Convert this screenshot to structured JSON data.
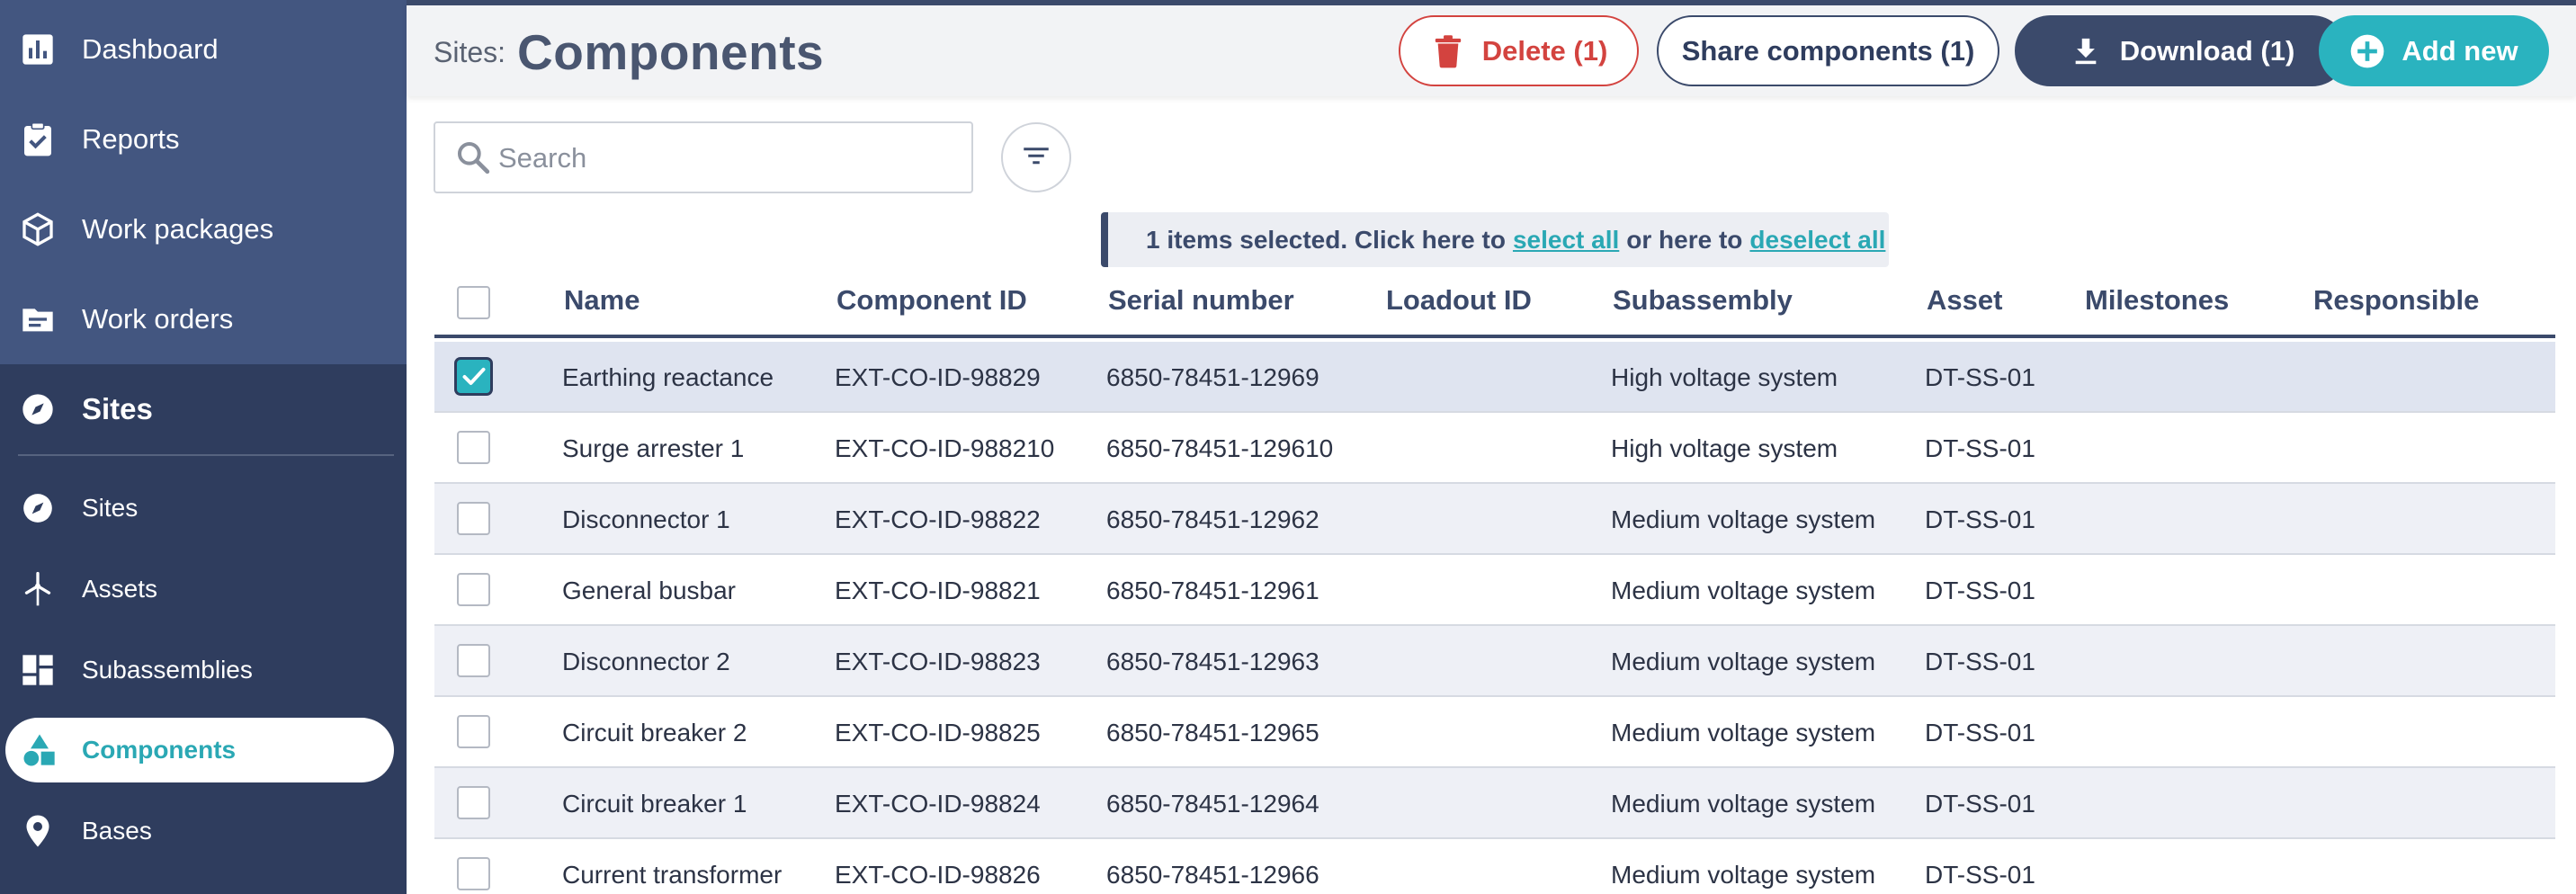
{
  "sidebar": {
    "main_items": [
      {
        "label": "Dashboard",
        "icon": "bar-chart-icon"
      },
      {
        "label": "Reports",
        "icon": "clipboard-check-icon"
      },
      {
        "label": "Work packages",
        "icon": "package-icon"
      },
      {
        "label": "Work orders",
        "icon": "folder-icon"
      }
    ],
    "section": {
      "label": "Sites",
      "icon": "compass-icon"
    },
    "sub_items": [
      {
        "label": "Sites",
        "icon": "compass-icon"
      },
      {
        "label": "Assets",
        "icon": "wind-turbine-icon"
      },
      {
        "label": "Subassemblies",
        "icon": "dashboard-grid-icon"
      },
      {
        "label": "Components",
        "icon": "shapes-icon"
      },
      {
        "label": "Bases",
        "icon": "map-pin-icon"
      }
    ],
    "active_sub": "Components",
    "colors": {
      "bg_top": "#435680",
      "bg_bottom": "#2f3d5e",
      "active_text": "#2aa8b4"
    }
  },
  "header": {
    "crumb": "Sites:",
    "title": "Components",
    "buttons": {
      "delete": "Delete (1)",
      "share": "Share components (1)",
      "download": "Download (1)",
      "add": "Add new"
    }
  },
  "search": {
    "placeholder": "Search",
    "value": ""
  },
  "banner": {
    "prefix": "1 items selected. Click here to",
    "select_all": "select all",
    "middle": "or here to",
    "deselect_all": "deselect all"
  },
  "table": {
    "columns": [
      "Name",
      "Component ID",
      "Serial number",
      "Loadout ID",
      "Subassembly",
      "Asset",
      "Milestones",
      "Responsible"
    ],
    "rows": [
      {
        "checked": true,
        "name": "Earthing reactance",
        "component_id": "EXT-CO-ID-98829",
        "serial": "6850-78451-12969",
        "loadout": "",
        "subassembly": "High voltage system",
        "asset": "DT-SS-01",
        "milestones": "",
        "responsible": ""
      },
      {
        "checked": false,
        "name": "Surge arrester 1",
        "component_id": "EXT-CO-ID-988210",
        "serial": "6850-78451-129610",
        "loadout": "",
        "subassembly": "High voltage system",
        "asset": "DT-SS-01",
        "milestones": "",
        "responsible": ""
      },
      {
        "checked": false,
        "name": "Disconnector 1",
        "component_id": "EXT-CO-ID-98822",
        "serial": "6850-78451-12962",
        "loadout": "",
        "subassembly": "Medium voltage system",
        "asset": "DT-SS-01",
        "milestones": "",
        "responsible": ""
      },
      {
        "checked": false,
        "name": "General busbar",
        "component_id": "EXT-CO-ID-98821",
        "serial": "6850-78451-12961",
        "loadout": "",
        "subassembly": "Medium voltage system",
        "asset": "DT-SS-01",
        "milestones": "",
        "responsible": ""
      },
      {
        "checked": false,
        "name": "Disconnector 2",
        "component_id": "EXT-CO-ID-98823",
        "serial": "6850-78451-12963",
        "loadout": "",
        "subassembly": "Medium voltage system",
        "asset": "DT-SS-01",
        "milestones": "",
        "responsible": ""
      },
      {
        "checked": false,
        "name": "Circuit breaker 2",
        "component_id": "EXT-CO-ID-98825",
        "serial": "6850-78451-12965",
        "loadout": "",
        "subassembly": "Medium voltage system",
        "asset": "DT-SS-01",
        "milestones": "",
        "responsible": ""
      },
      {
        "checked": false,
        "name": "Circuit breaker 1",
        "component_id": "EXT-CO-ID-98824",
        "serial": "6850-78451-12964",
        "loadout": "",
        "subassembly": "Medium voltage system",
        "asset": "DT-SS-01",
        "milestones": "",
        "responsible": ""
      },
      {
        "checked": false,
        "name": "Current transformer",
        "component_id": "EXT-CO-ID-98826",
        "serial": "6850-78451-12966",
        "loadout": "",
        "subassembly": "Medium voltage system",
        "asset": "DT-SS-01",
        "milestones": "",
        "responsible": ""
      }
    ]
  },
  "colors": {
    "primary": "#3b4a6b",
    "accent": "#2ab3bf",
    "danger": "#d3433f"
  }
}
